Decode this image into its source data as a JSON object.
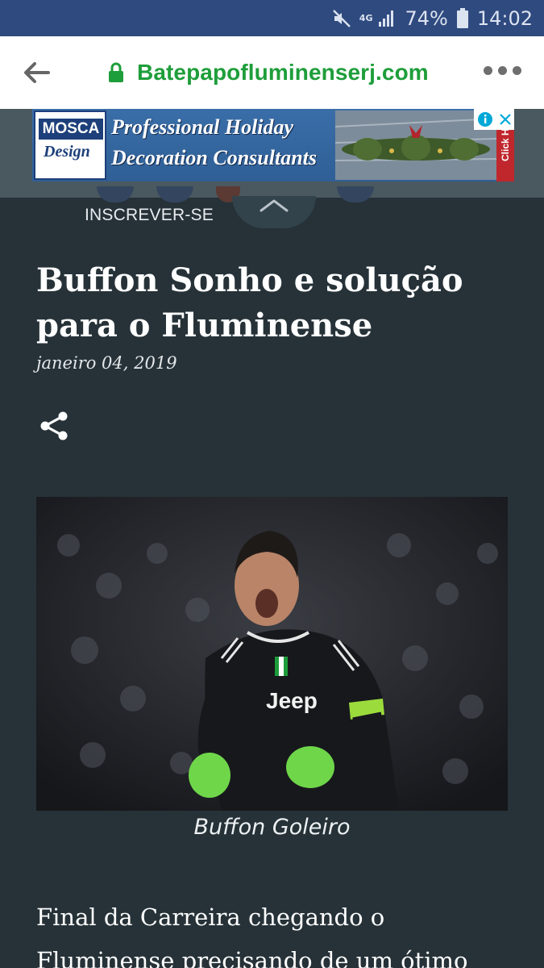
{
  "status_bar": {
    "network": "4G",
    "battery": "74%",
    "time": "14:02",
    "icons": [
      "mute-icon",
      "signal-icon",
      "battery-icon"
    ]
  },
  "browser": {
    "url": "Batepapofluminenserj.com",
    "icons": [
      "back-arrow-icon",
      "lock-icon",
      "more-menu-icon"
    ],
    "url_color": "#1e9e3a"
  },
  "ad": {
    "logo_line1": "MOSCA",
    "logo_line2": "Design",
    "line1": "Professional Holiday",
    "line2": "Decoration Consultants",
    "side_text": "Click H",
    "icons": [
      "ad-info-icon",
      "ad-close-icon"
    ]
  },
  "subscribe": {
    "label": "INSCREVER-SE"
  },
  "article": {
    "title": "Buffon Sonho e solução para o Fluminense",
    "date": "janeiro 04, 2019",
    "image_caption": "Buffon Goleiro",
    "body_lines": [
      "Final da Carreira chegando o",
      "Fluminense precisando de um ótimo"
    ]
  },
  "colors": {
    "page_background": "#263238",
    "status_bar": "#2f4a7f",
    "toolbar": "#ffffff"
  }
}
